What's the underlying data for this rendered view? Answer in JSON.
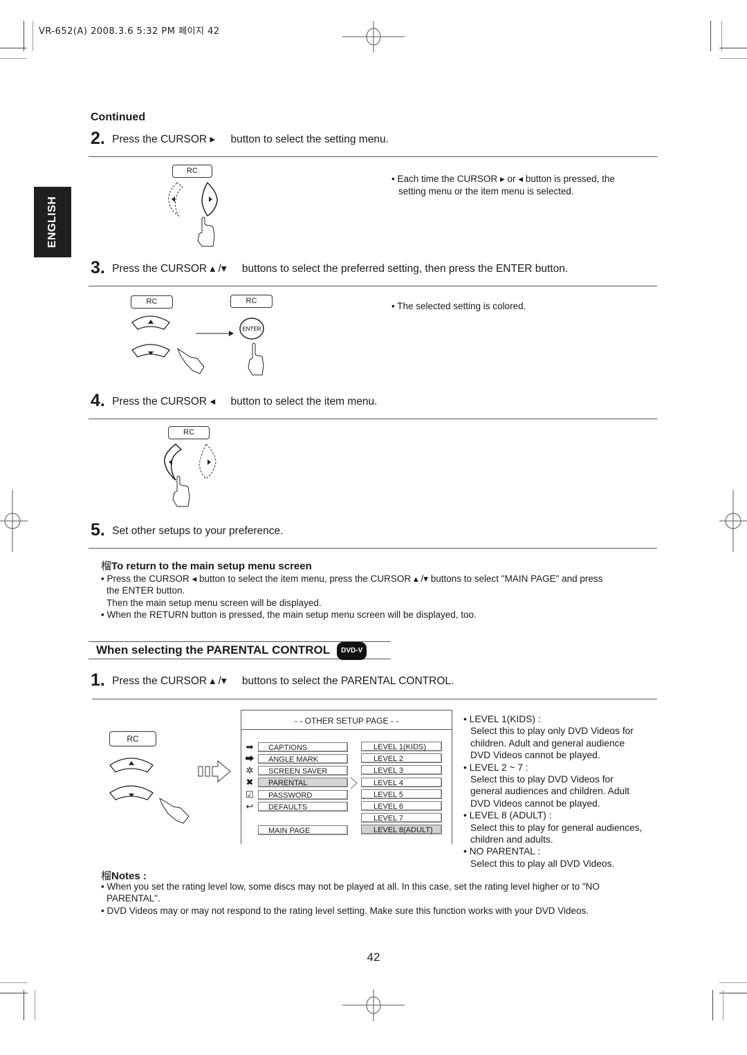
{
  "header": {
    "print_info": "VR-652(A) 2008.3.6 5:32 PM 페이지 42"
  },
  "language_tab": "ENGLISH",
  "continued_label": "Continued",
  "rc_label": "RC",
  "enter_label": "ENTER",
  "icons": {
    "right": "▸",
    "left": "◂",
    "up": "▴",
    "down": "▾"
  },
  "steps": [
    {
      "number": "2.",
      "text_before": "Press the CURSOR ▸",
      "text_after": "button to select the setting menu.",
      "note": "• Each time the CURSOR ▸   or ◂   button is pressed, the",
      "note_line2": "setting menu or the item menu is selected."
    },
    {
      "number": "3.",
      "text_before": "Press the CURSOR ▴ /▾",
      "text_after": "buttons to select the preferred setting, then press the ENTER button.",
      "note": "• The selected setting is colored."
    },
    {
      "number": "4.",
      "text_before": "Press the CURSOR ◂",
      "text_after": "button to select the item menu."
    },
    {
      "number": "5.",
      "text_before": "Set other setups to your preference.",
      "text_after": ""
    }
  ],
  "return_section": {
    "heading_mark": "榴",
    "heading": "To return to the main setup menu screen",
    "bullets": [
      "• Press the CURSOR ◂   button to select the item menu, press the CURSOR ▴ /▾   buttons to select \"MAIN PAGE\" and press",
      "the ENTER button.",
      "Then the main setup menu screen will be displayed.",
      "• When the RETURN button is pressed, the main setup menu screen will be displayed, too."
    ]
  },
  "parental_section": {
    "title": "When selecting the PARENTAL CONTROL",
    "badge": "DVD-V",
    "step": {
      "number": "1.",
      "text_before": "Press the CURSOR ▴ /▾",
      "text_after": "buttons to select the PARENTAL CONTROL."
    },
    "osd": {
      "title": "- - OTHER SETUP PAGE - -",
      "items": [
        {
          "label": "CAPTIONS",
          "icon": "captions-icon",
          "glyph": "➡",
          "selected": false
        },
        {
          "label": "ANGLE MARK",
          "icon": "angle-mark-icon",
          "glyph": "⮕",
          "selected": false
        },
        {
          "label": "SCREEN SAVER",
          "icon": "screen-saver-icon",
          "glyph": "✲",
          "selected": false
        },
        {
          "label": "PARENTAL",
          "icon": "parental-icon",
          "glyph": "✖",
          "selected": true
        },
        {
          "label": "PASSWORD",
          "icon": "password-icon",
          "glyph": "☑",
          "selected": false
        },
        {
          "label": "DEFAULTS",
          "icon": "defaults-icon",
          "glyph": "↩",
          "selected": false
        }
      ],
      "main_page": "MAIN PAGE",
      "levels": [
        {
          "label": "LEVEL 1(KIDS)",
          "selected": false
        },
        {
          "label": "LEVEL 2",
          "selected": false
        },
        {
          "label": "LEVEL 3",
          "selected": false
        },
        {
          "label": "LEVEL 4",
          "selected": false
        },
        {
          "label": "LEVEL 5",
          "selected": false
        },
        {
          "label": "LEVEL 6",
          "selected": false
        },
        {
          "label": "LEVEL 7",
          "selected": false
        },
        {
          "label": "LEVEL 8(ADULT)",
          "selected": true
        }
      ]
    },
    "descriptions": [
      {
        "head": "• LEVEL 1(KIDS) :",
        "lines": [
          "Select this to play only DVD Videos for",
          "children. Adult and general audience",
          "DVD Videos cannot be played."
        ]
      },
      {
        "head": "• LEVEL 2 ~ 7 :",
        "lines": [
          "Select this to play DVD Videos for",
          "general audiences and children. Adult",
          "DVD Videos cannot be played."
        ]
      },
      {
        "head": "• LEVEL 8 (ADULT) :",
        "lines": [
          "Select this to play for general audiences,",
          "children and adults."
        ]
      },
      {
        "head": "• NO PARENTAL :",
        "lines": [
          "Select this to play all DVD Videos."
        ]
      }
    ]
  },
  "notes": {
    "heading_mark": "榴",
    "heading": "Notes :",
    "bullets": [
      "• When you set the rating level low, some discs may not be played at all. In this case, set the rating level higher or to \"NO",
      "PARENTAL\".",
      "• DVD Videos may or may not respond to the rating level setting. Make sure this function works with your DVD Videos."
    ]
  },
  "page_number": "42"
}
